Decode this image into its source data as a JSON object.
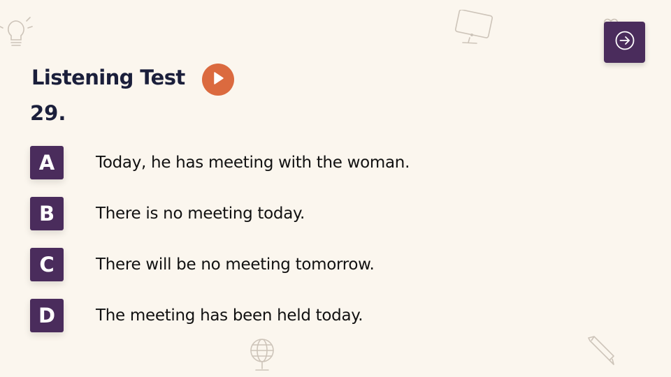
{
  "header": {
    "title": "Listening Test",
    "question_number": "29."
  },
  "icons": {
    "next": "arrow-right-circle-icon",
    "play": "play-icon"
  },
  "options": [
    {
      "letter": "A",
      "text": "Today, he has meeting with the woman."
    },
    {
      "letter": "B",
      "text": "There is no meeting today."
    },
    {
      "letter": "C",
      "text": "There will be no meeting tomorrow."
    },
    {
      "letter": "D",
      "text": "The meeting has been held today."
    }
  ],
  "colors": {
    "background": "#fbf6ee",
    "accent_purple": "#4a2c5c",
    "play_orange": "#db6a3f",
    "title_navy": "#1b1f3b"
  }
}
